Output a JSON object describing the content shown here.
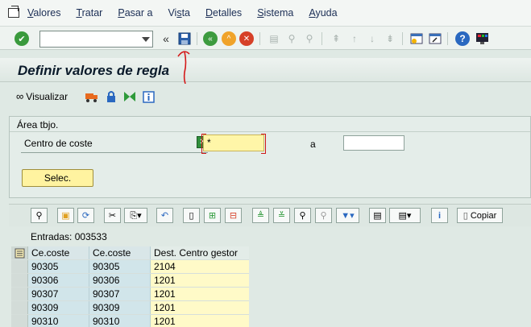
{
  "menu": {
    "items": [
      "Valores",
      "Tratar",
      "Pasar a",
      "Vista",
      "Detalles",
      "Sistema",
      "Ayuda"
    ],
    "underlines": [
      "V",
      "T",
      "P",
      "s",
      "D",
      "S",
      "A"
    ]
  },
  "toolbar": {
    "command_value": "",
    "expand_glyph": "«"
  },
  "title": "Definir valores de regla",
  "app_toolbar": {
    "visualize_label": "Visualizar"
  },
  "selection": {
    "group_title": "Área tbjo.",
    "field_label": "Centro de coste",
    "from_value": "*",
    "to_label": "a",
    "to_value": "",
    "button_label": "Selec."
  },
  "table_toolbar": {
    "copy_label": "Copiar"
  },
  "entries_text": "Entradas: 003533",
  "table": {
    "headers": [
      "Ce.coste",
      "Ce.coste",
      "Dest. Centro gestor"
    ],
    "rows": [
      [
        "90305",
        "90305",
        "2104"
      ],
      [
        "90306",
        "90306",
        "1201"
      ],
      [
        "90307",
        "90307",
        "1201"
      ],
      [
        "90309",
        "90309",
        "1201"
      ],
      [
        "90310",
        "90310",
        "1201"
      ]
    ]
  },
  "colors": {
    "background": "#dfe9e4",
    "key_column": "#d1e5ea",
    "value_column": "#fffac8",
    "annotation": "#d41a1a"
  }
}
